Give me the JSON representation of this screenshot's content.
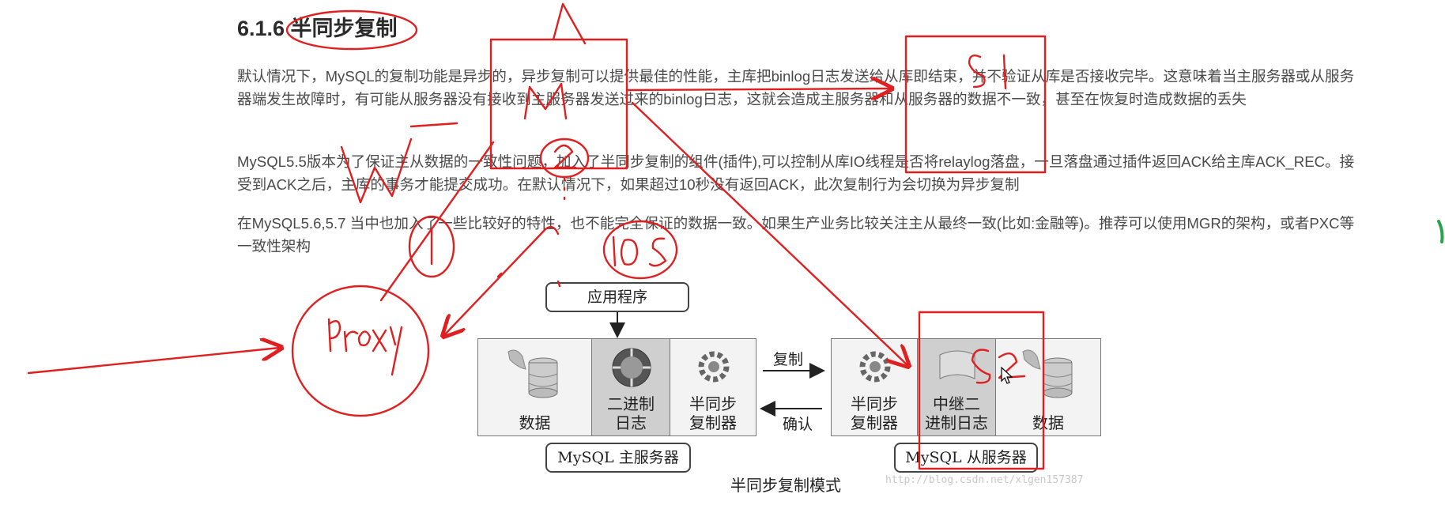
{
  "article": {
    "heading": "6.1.6 半同步复制",
    "paragraphs": [
      "默认情况下，MySQL的复制功能是异步的，异步复制可以提供最佳的性能，主库把binlog日志发送给从库即结束，并不验证从库是否接收完毕。这意味着当主服务器或从服务器端发生故障时，有可能从服务器没有接收到主服务器发送过来的binlog日志，这就会造成主服务器和从服务器的数据不一致，甚至在恢复时造成数据的丢失",
      "MySQL5.5版本为了保证主从数据的一致性问题，加入了半同步复制的组件(插件),可以控制从库IO线程是否将relaylog落盘，一旦落盘通过插件返回ACK给主库ACK_REC。接受到ACK之后，主库的事务才能提交成功。在默认情况下，如果超过10秒没有返回ACK，此次复制行为会切换为异步复制",
      "在MySQL5.6,5.7 当中也加入了一些比较好的特性，也不能完全保证的数据一致。如果生产业务比较关注主从最终一致(比如:金融等)。推荐可以使用MGR的架构，或者PXC等一致性架构"
    ]
  },
  "diagram": {
    "app_label": "应用程序",
    "master": {
      "cells": [
        "数据",
        "二进制\n日志",
        "半同步\n复制器"
      ],
      "label": "MySQL 主服务器"
    },
    "slave": {
      "cells": [
        "半同步\n复制器",
        "中继二\n进制日志",
        "数据"
      ],
      "label": "MySQL 从服务器"
    },
    "replicate_label": "复制",
    "ack_label": "确认",
    "caption": "半同步复制模式",
    "watermark": "http://blog.csdn.net/xlgen157387"
  },
  "annotations": {
    "master_letter": "M",
    "slave_letters": [
      "S1",
      "S2"
    ],
    "proxy_text": "proxy",
    "write_letter": "W",
    "step_numbers": [
      "1",
      "2"
    ],
    "timeout_text": "10s",
    "ink_color": "#e02020"
  }
}
